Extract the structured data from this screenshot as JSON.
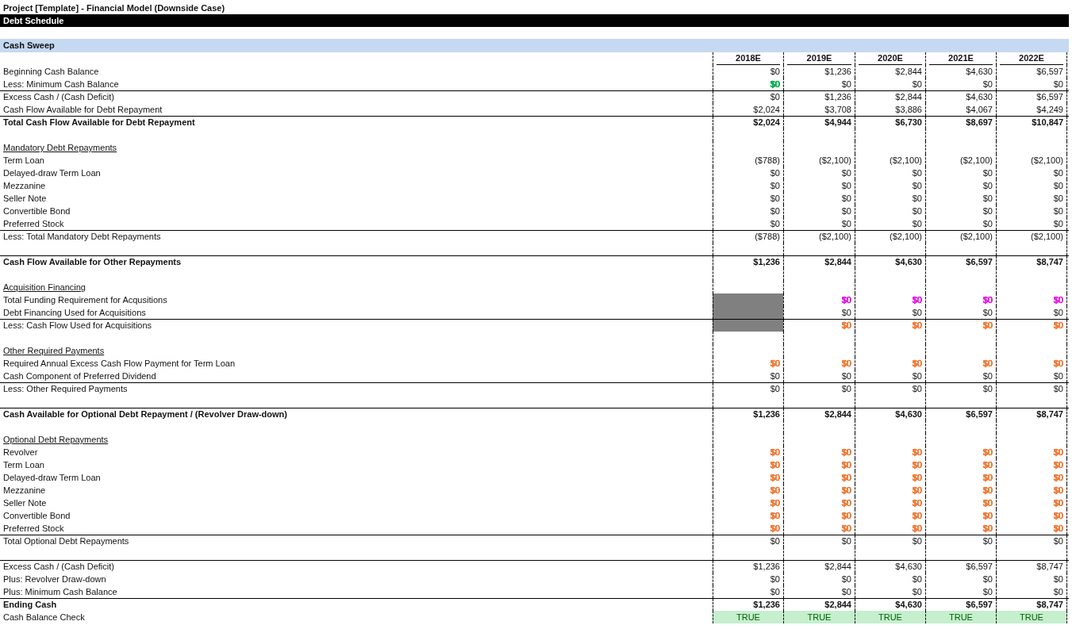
{
  "title": "Project [Template] - Financial Model (Downside Case)",
  "banner": "Debt Schedule",
  "section": "Cash Sweep",
  "columns": [
    "2018E",
    "2019E",
    "2020E",
    "2021E",
    "2022E"
  ],
  "rows": [
    {
      "kind": "line",
      "label": "Beginning Cash Balance",
      "rule_above": false,
      "cells": [
        {
          "text": "$0"
        },
        {
          "text": "$1,236"
        },
        {
          "text": "$2,844"
        },
        {
          "text": "$4,630"
        },
        {
          "text": "$6,597"
        }
      ]
    },
    {
      "kind": "line",
      "label": "Less: Minimum Cash Balance",
      "rule_above": false,
      "cells": [
        {
          "text": "$0",
          "color": "#00b050"
        },
        {
          "text": "$0"
        },
        {
          "text": "$0"
        },
        {
          "text": "$0"
        },
        {
          "text": "$0"
        }
      ]
    },
    {
      "kind": "line",
      "label": "Excess Cash / (Cash Deficit)",
      "rule_above": true,
      "cells": [
        {
          "text": "$0"
        },
        {
          "text": "$1,236"
        },
        {
          "text": "$2,844"
        },
        {
          "text": "$4,630"
        },
        {
          "text": "$6,597"
        }
      ]
    },
    {
      "kind": "line",
      "label": "Cash Flow Available for Debt Repayment",
      "rule_above": false,
      "cells": [
        {
          "text": "$2,024"
        },
        {
          "text": "$3,708"
        },
        {
          "text": "$3,886"
        },
        {
          "text": "$4,067"
        },
        {
          "text": "$4,249"
        }
      ]
    },
    {
      "kind": "total",
      "label": "Total Cash Flow Available for Debt Repayment",
      "rule_above": true,
      "cells": [
        {
          "text": "$2,024"
        },
        {
          "text": "$4,944"
        },
        {
          "text": "$6,730"
        },
        {
          "text": "$8,697"
        },
        {
          "text": "$10,847"
        }
      ]
    },
    {
      "kind": "blank",
      "rule_above": false
    },
    {
      "kind": "heading",
      "label": "Mandatory Debt Repayments",
      "rule_above": false
    },
    {
      "kind": "line",
      "label": "Term Loan",
      "rule_above": false,
      "cells": [
        {
          "text": "($788)"
        },
        {
          "text": "($2,100)"
        },
        {
          "text": "($2,100)"
        },
        {
          "text": "($2,100)"
        },
        {
          "text": "($2,100)"
        }
      ]
    },
    {
      "kind": "line",
      "label": "Delayed-draw Term Loan",
      "rule_above": false,
      "cells": [
        {
          "text": "$0"
        },
        {
          "text": "$0"
        },
        {
          "text": "$0"
        },
        {
          "text": "$0"
        },
        {
          "text": "$0"
        }
      ]
    },
    {
      "kind": "line",
      "label": "Mezzanine",
      "rule_above": false,
      "cells": [
        {
          "text": "$0"
        },
        {
          "text": "$0"
        },
        {
          "text": "$0"
        },
        {
          "text": "$0"
        },
        {
          "text": "$0"
        }
      ]
    },
    {
      "kind": "line",
      "label": "Seller Note",
      "rule_above": false,
      "cells": [
        {
          "text": "$0"
        },
        {
          "text": "$0"
        },
        {
          "text": "$0"
        },
        {
          "text": "$0"
        },
        {
          "text": "$0"
        }
      ]
    },
    {
      "kind": "line",
      "label": "Convertible Bond",
      "rule_above": false,
      "cells": [
        {
          "text": "$0"
        },
        {
          "text": "$0"
        },
        {
          "text": "$0"
        },
        {
          "text": "$0"
        },
        {
          "text": "$0"
        }
      ]
    },
    {
      "kind": "line",
      "label": "Preferred Stock",
      "rule_above": false,
      "cells": [
        {
          "text": "$0"
        },
        {
          "text": "$0"
        },
        {
          "text": "$0"
        },
        {
          "text": "$0"
        },
        {
          "text": "$0"
        }
      ]
    },
    {
      "kind": "line",
      "label": "Less: Total Mandatory Debt Repayments",
      "rule_above": true,
      "cells": [
        {
          "text": "($788)"
        },
        {
          "text": "($2,100)"
        },
        {
          "text": "($2,100)"
        },
        {
          "text": "($2,100)"
        },
        {
          "text": "($2,100)"
        }
      ]
    },
    {
      "kind": "blank",
      "rule_above": false
    },
    {
      "kind": "total",
      "label": "Cash Flow Available for Other Repayments",
      "rule_above": true,
      "cells": [
        {
          "text": "$1,236"
        },
        {
          "text": "$2,844"
        },
        {
          "text": "$4,630"
        },
        {
          "text": "$6,597"
        },
        {
          "text": "$8,747"
        }
      ]
    },
    {
      "kind": "blank",
      "rule_above": false
    },
    {
      "kind": "heading",
      "label": "Acquisition Financing",
      "rule_above": false
    },
    {
      "kind": "line",
      "label": "Total Funding Requirement for Acqusitions",
      "rule_above": false,
      "cells": [
        {
          "shaded": true
        },
        {
          "text": "$0",
          "color": "#e81ee8"
        },
        {
          "text": "$0",
          "color": "#e81ee8"
        },
        {
          "text": "$0",
          "color": "#e81ee8"
        },
        {
          "text": "$0",
          "color": "#e81ee8"
        }
      ]
    },
    {
      "kind": "line",
      "label": "Debt Financing Used for Acquisitions",
      "rule_above": false,
      "cells": [
        {
          "shaded": true
        },
        {
          "text": "$0"
        },
        {
          "text": "$0"
        },
        {
          "text": "$0"
        },
        {
          "text": "$0"
        }
      ]
    },
    {
      "kind": "line",
      "label": "Less: Cash Flow Used for Acquisitions",
      "rule_above": true,
      "cells": [
        {
          "shaded": true
        },
        {
          "text": "$0",
          "color": "#f07c3a"
        },
        {
          "text": "$0",
          "color": "#f07c3a"
        },
        {
          "text": "$0",
          "color": "#f07c3a"
        },
        {
          "text": "$0",
          "color": "#f07c3a"
        }
      ]
    },
    {
      "kind": "blank",
      "rule_above": false
    },
    {
      "kind": "heading",
      "label": "Other Required Payments",
      "rule_above": false
    },
    {
      "kind": "line",
      "label": "Required Annual Excess Cash Flow Payment for Term Loan",
      "rule_above": false,
      "cells": [
        {
          "text": "$0",
          "color": "#f07c3a"
        },
        {
          "text": "$0",
          "color": "#f07c3a"
        },
        {
          "text": "$0",
          "color": "#f07c3a"
        },
        {
          "text": "$0",
          "color": "#f07c3a"
        },
        {
          "text": "$0",
          "color": "#f07c3a"
        }
      ]
    },
    {
      "kind": "line",
      "label": "Cash Component of Preferred Dividend",
      "rule_above": false,
      "cells": [
        {
          "text": "$0"
        },
        {
          "text": "$0"
        },
        {
          "text": "$0"
        },
        {
          "text": "$0"
        },
        {
          "text": "$0"
        }
      ]
    },
    {
      "kind": "line",
      "label": "Less: Other Required Payments",
      "rule_above": true,
      "cells": [
        {
          "text": "$0"
        },
        {
          "text": "$0"
        },
        {
          "text": "$0"
        },
        {
          "text": "$0"
        },
        {
          "text": "$0"
        }
      ]
    },
    {
      "kind": "blank",
      "rule_above": false
    },
    {
      "kind": "total",
      "label": "Cash Available for Optional Debt Repayment / (Revolver Draw-down)",
      "rule_above": true,
      "cells": [
        {
          "text": "$1,236"
        },
        {
          "text": "$2,844"
        },
        {
          "text": "$4,630"
        },
        {
          "text": "$6,597"
        },
        {
          "text": "$8,747"
        }
      ]
    },
    {
      "kind": "blank",
      "rule_above": false
    },
    {
      "kind": "heading",
      "label": "Optional Debt Repayments",
      "rule_above": false
    },
    {
      "kind": "line",
      "label": "Revolver",
      "rule_above": false,
      "cells": [
        {
          "text": "$0",
          "color": "#f07c3a"
        },
        {
          "text": "$0",
          "color": "#f07c3a"
        },
        {
          "text": "$0",
          "color": "#f07c3a"
        },
        {
          "text": "$0",
          "color": "#f07c3a"
        },
        {
          "text": "$0",
          "color": "#f07c3a"
        }
      ]
    },
    {
      "kind": "line",
      "label": "Term Loan",
      "rule_above": false,
      "cells": [
        {
          "text": "$0",
          "color": "#f07c3a"
        },
        {
          "text": "$0",
          "color": "#f07c3a"
        },
        {
          "text": "$0",
          "color": "#f07c3a"
        },
        {
          "text": "$0",
          "color": "#f07c3a"
        },
        {
          "text": "$0",
          "color": "#f07c3a"
        }
      ]
    },
    {
      "kind": "line",
      "label": "Delayed-draw Term Loan",
      "rule_above": false,
      "cells": [
        {
          "text": "$0",
          "color": "#f07c3a"
        },
        {
          "text": "$0",
          "color": "#f07c3a"
        },
        {
          "text": "$0",
          "color": "#f07c3a"
        },
        {
          "text": "$0",
          "color": "#f07c3a"
        },
        {
          "text": "$0",
          "color": "#f07c3a"
        }
      ]
    },
    {
      "kind": "line",
      "label": "Mezzanine",
      "rule_above": false,
      "cells": [
        {
          "text": "$0",
          "color": "#f07c3a"
        },
        {
          "text": "$0",
          "color": "#f07c3a"
        },
        {
          "text": "$0",
          "color": "#f07c3a"
        },
        {
          "text": "$0",
          "color": "#f07c3a"
        },
        {
          "text": "$0",
          "color": "#f07c3a"
        }
      ]
    },
    {
      "kind": "line",
      "label": "Seller Note",
      "rule_above": false,
      "cells": [
        {
          "text": "$0",
          "color": "#f07c3a"
        },
        {
          "text": "$0",
          "color": "#f07c3a"
        },
        {
          "text": "$0",
          "color": "#f07c3a"
        },
        {
          "text": "$0",
          "color": "#f07c3a"
        },
        {
          "text": "$0",
          "color": "#f07c3a"
        }
      ]
    },
    {
      "kind": "line",
      "label": "Convertible Bond",
      "rule_above": false,
      "cells": [
        {
          "text": "$0",
          "color": "#f07c3a"
        },
        {
          "text": "$0",
          "color": "#f07c3a"
        },
        {
          "text": "$0",
          "color": "#f07c3a"
        },
        {
          "text": "$0",
          "color": "#f07c3a"
        },
        {
          "text": "$0",
          "color": "#f07c3a"
        }
      ]
    },
    {
      "kind": "line",
      "label": "Preferred Stock",
      "rule_above": false,
      "cells": [
        {
          "text": "$0",
          "color": "#f07c3a"
        },
        {
          "text": "$0",
          "color": "#f07c3a"
        },
        {
          "text": "$0",
          "color": "#f07c3a"
        },
        {
          "text": "$0",
          "color": "#f07c3a"
        },
        {
          "text": "$0",
          "color": "#f07c3a"
        }
      ]
    },
    {
      "kind": "line",
      "label": "Total Optional Debt Repayments",
      "rule_above": true,
      "cells": [
        {
          "text": "$0"
        },
        {
          "text": "$0"
        },
        {
          "text": "$0"
        },
        {
          "text": "$0"
        },
        {
          "text": "$0"
        }
      ]
    },
    {
      "kind": "blank",
      "rule_above": false
    },
    {
      "kind": "line",
      "label": "Excess Cash / (Cash Deficit)",
      "rule_above": true,
      "cells": [
        {
          "text": "$1,236"
        },
        {
          "text": "$2,844"
        },
        {
          "text": "$4,630"
        },
        {
          "text": "$6,597"
        },
        {
          "text": "$8,747"
        }
      ]
    },
    {
      "kind": "line",
      "label": "Plus: Revolver Draw-down",
      "rule_above": false,
      "cells": [
        {
          "text": "$0"
        },
        {
          "text": "$0"
        },
        {
          "text": "$0"
        },
        {
          "text": "$0"
        },
        {
          "text": "$0"
        }
      ]
    },
    {
      "kind": "line",
      "label": "Plus: Minimum Cash Balance",
      "rule_above": false,
      "cells": [
        {
          "text": "$0"
        },
        {
          "text": "$0"
        },
        {
          "text": "$0"
        },
        {
          "text": "$0"
        },
        {
          "text": "$0"
        }
      ]
    },
    {
      "kind": "total",
      "label": "Ending Cash",
      "rule_above": true,
      "cells": [
        {
          "text": "$1,236"
        },
        {
          "text": "$2,844"
        },
        {
          "text": "$4,630"
        },
        {
          "text": "$6,597"
        },
        {
          "text": "$8,747"
        }
      ]
    },
    {
      "kind": "check",
      "label": "Cash Balance Check",
      "rule_above": false,
      "cells": [
        {
          "text": "TRUE"
        },
        {
          "text": "TRUE"
        },
        {
          "text": "TRUE"
        },
        {
          "text": "TRUE"
        },
        {
          "text": "TRUE"
        }
      ]
    }
  ]
}
